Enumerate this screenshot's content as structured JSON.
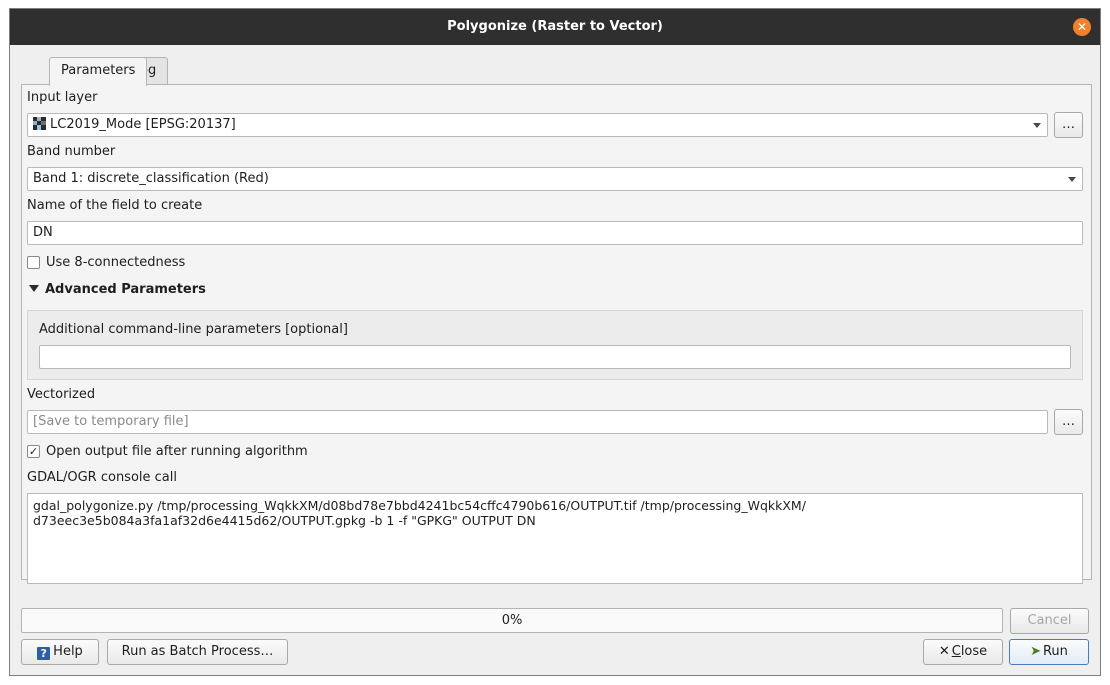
{
  "window": {
    "title": "Polygonize (Raster to Vector)"
  },
  "tabs": [
    {
      "label": "Parameters"
    },
    {
      "label": "Log"
    }
  ],
  "input_layer": {
    "label": "Input layer",
    "value": "LC2019_Mode [EPSG:20137]",
    "browse": "…"
  },
  "band_number": {
    "label": "Band number",
    "value": "Band 1: discrete_classification (Red)"
  },
  "field_name": {
    "label": "Name of the field to create",
    "value": "DN"
  },
  "connectedness": {
    "label": "Use 8-connectedness",
    "checked": false
  },
  "advanced": {
    "title": "Advanced Parameters",
    "extra_label": "Additional command-line parameters [optional]",
    "extra_value": ""
  },
  "vectorized": {
    "label": "Vectorized",
    "placeholder": "[Save to temporary file]",
    "browse": "…"
  },
  "open_output": {
    "label": "Open output file after running algorithm",
    "checked": true
  },
  "console": {
    "label": "GDAL/OGR console call",
    "line1": "gdal_polygonize.py /tmp/processing_WqkkXM/d08bd78e7bbd4241bc54cffc4790b616/OUTPUT.tif /tmp/processing_WqkkXM/",
    "line2": "d73eec3e5b084a3fa1af32d6e4415d62/OUTPUT.gpkg -b 1 -f \"GPKG\" OUTPUT DN"
  },
  "progress": {
    "text": "0%",
    "value": 0
  },
  "buttons": {
    "cancel": "Cancel",
    "help": "Help",
    "batch": "Run as Batch Process…",
    "close_c": "C",
    "close_rest": "lose",
    "run": "Run"
  }
}
